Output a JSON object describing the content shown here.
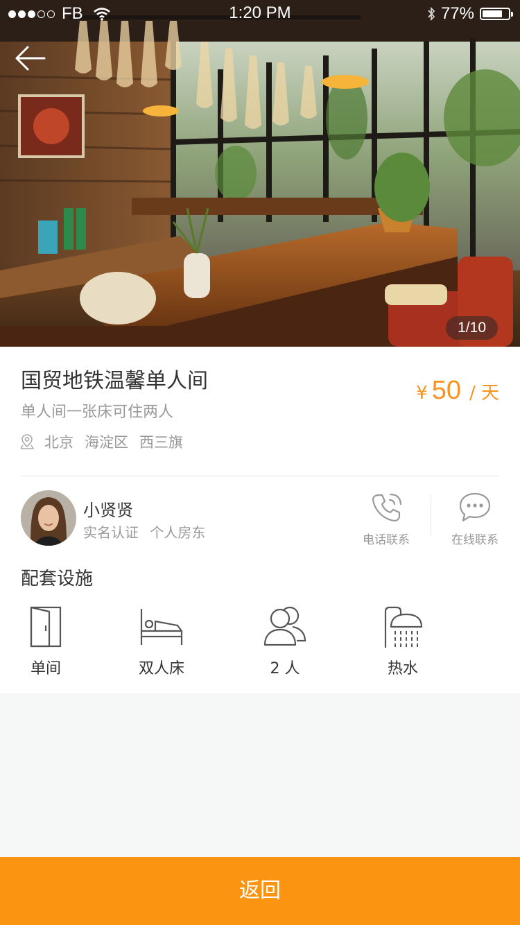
{
  "status_bar": {
    "carrier": "FB",
    "time": "1:20 PM",
    "battery_percent": "77%",
    "battery_level": 0.77
  },
  "gallery": {
    "pager": "1/10"
  },
  "listing": {
    "title": "国贸地铁温馨单人间",
    "subtitle": "单人间一张床可住两人",
    "location": [
      "北京",
      "海淀区",
      "西三旗"
    ],
    "price": {
      "currency": "¥",
      "amount": "50",
      "unit": "/ 天"
    }
  },
  "host": {
    "name": "小贤贤",
    "tags": [
      "实名认证",
      "个人房东"
    ]
  },
  "contact": {
    "phone_label": "电话联系",
    "chat_label": "在线联系"
  },
  "facilities": {
    "title": "配套设施",
    "items": [
      {
        "label": "单间",
        "icon": "door-icon"
      },
      {
        "label": "双人床",
        "icon": "bed-icon"
      },
      {
        "label": "2 人",
        "icon": "people-icon"
      },
      {
        "label": "热水",
        "icon": "shower-icon"
      }
    ]
  },
  "footer": {
    "back_label": "返回"
  },
  "colors": {
    "accent": "#f7931e",
    "button": "#fb9511"
  }
}
